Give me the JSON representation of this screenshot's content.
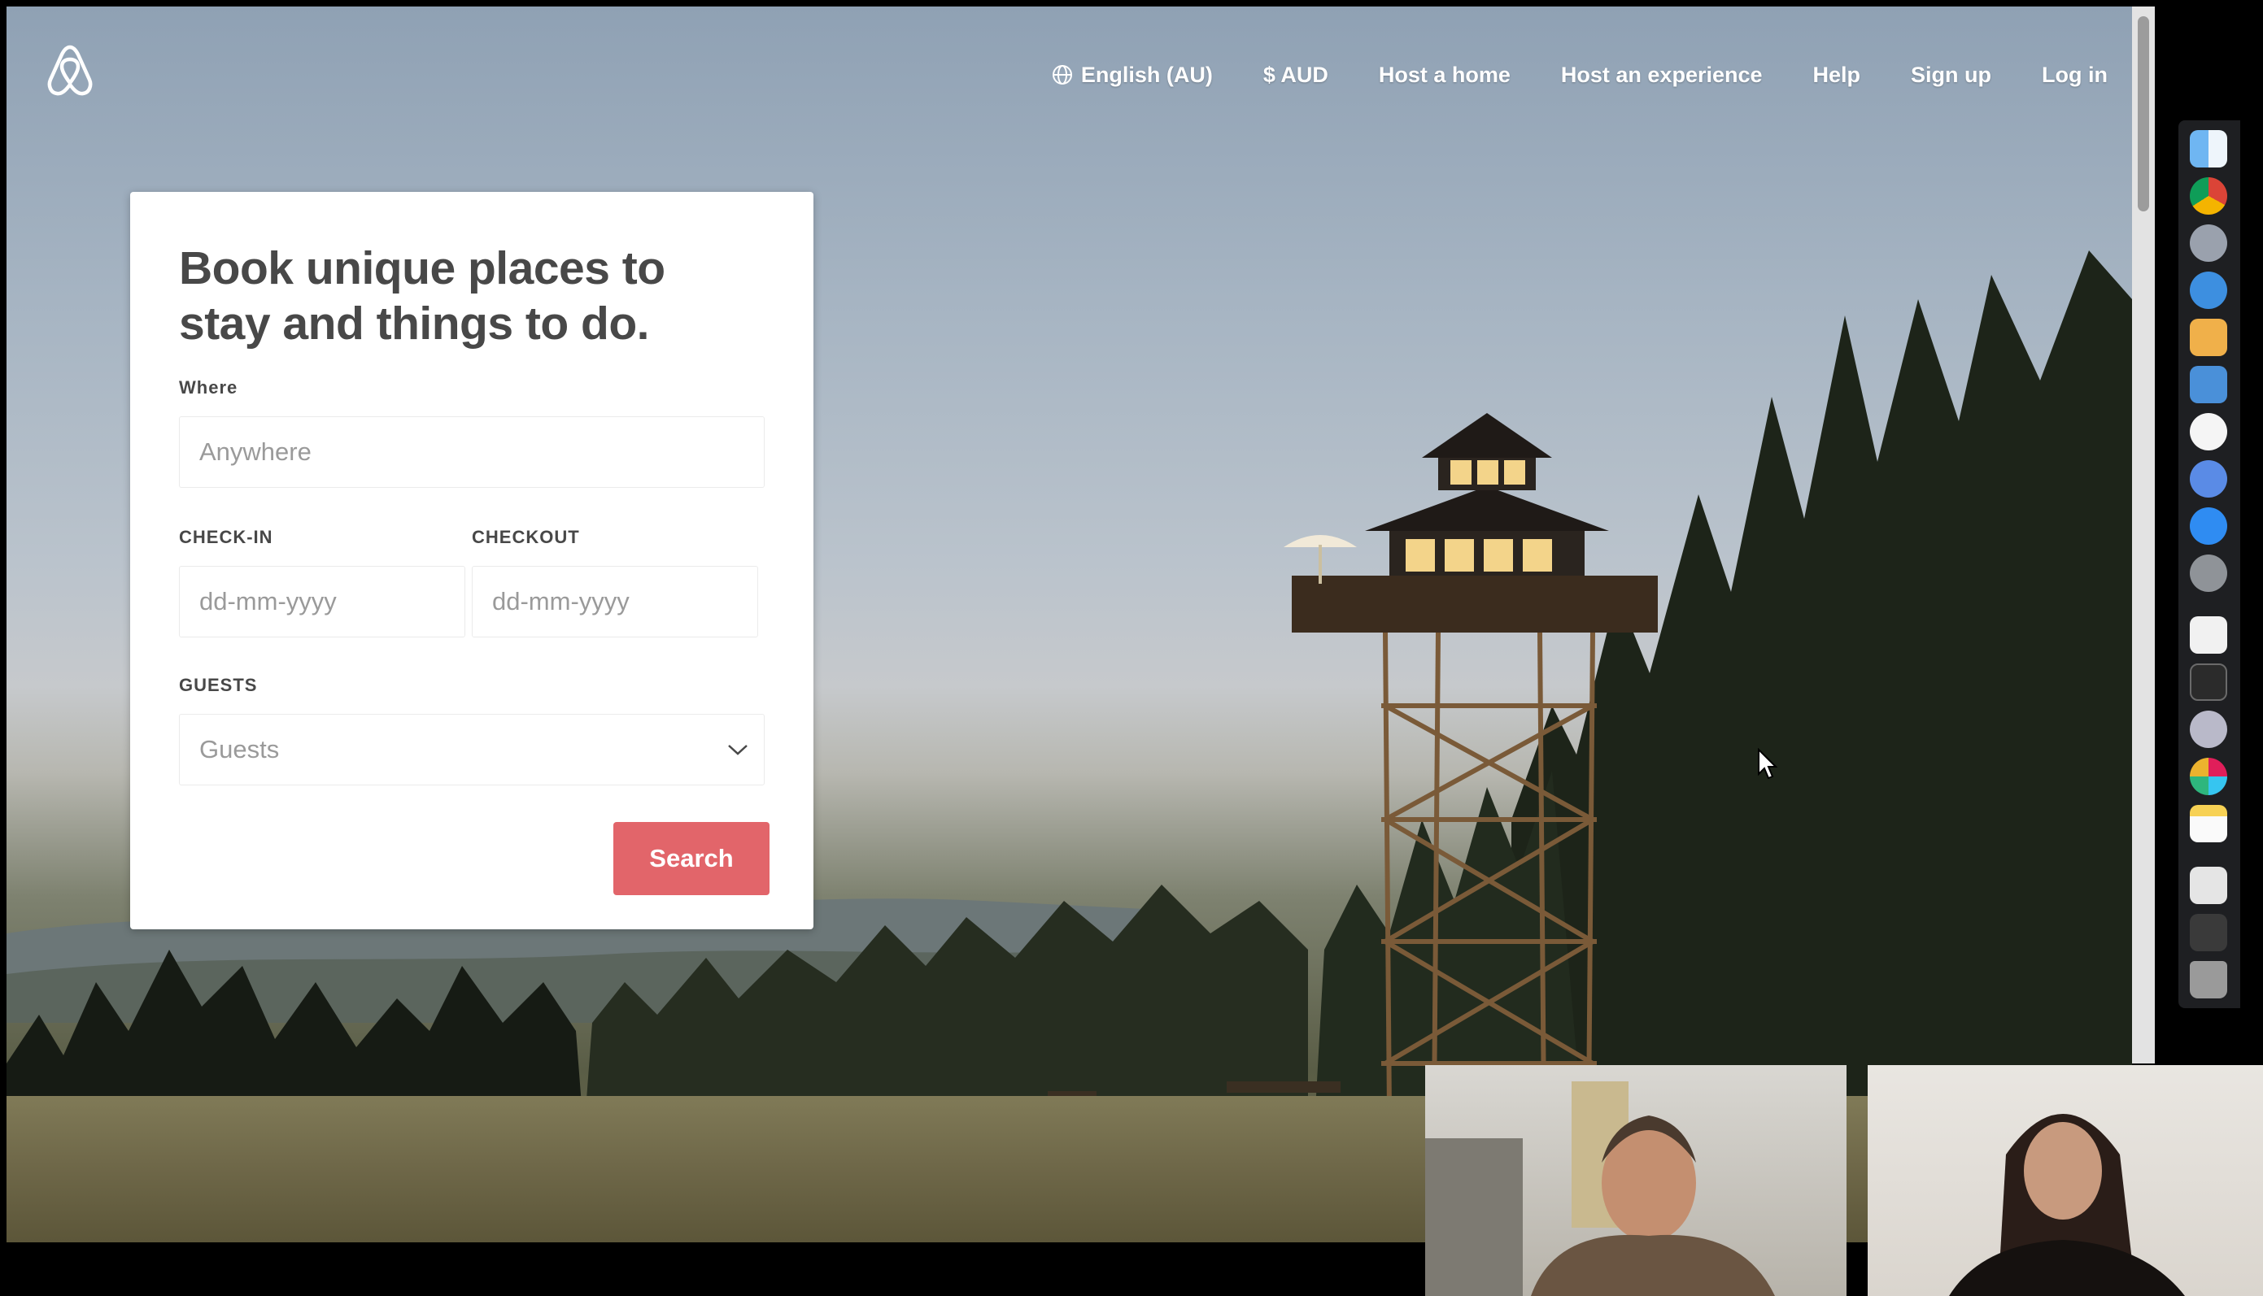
{
  "nav": {
    "language": "English (AU)",
    "currency": "$ AUD",
    "host_home": "Host a home",
    "host_experience": "Host an experience",
    "help": "Help",
    "signup": "Sign up",
    "login": "Log in"
  },
  "card": {
    "headline": "Book unique places to stay and things to do.",
    "where_label": "Where",
    "where_placeholder": "Anywhere",
    "checkin_label": "CHECK-IN",
    "checkin_placeholder": "dd-mm-yyyy",
    "checkout_label": "CHECKOUT",
    "checkout_placeholder": "dd-mm-yyyy",
    "guests_label": "GUESTS",
    "guests_value": "Guests",
    "search_label": "Search"
  },
  "colors": {
    "brand": "#e2656a",
    "text": "#484848"
  },
  "dock": {
    "icons": [
      "finder-icon",
      "chrome-icon",
      "launchpad-icon",
      "safari-icon",
      "stickies-icon",
      "keynote-icon",
      "itunes-icon",
      "siri-icon",
      "app-store-icon",
      "system-preferences-icon",
      "textedit-icon",
      "terminal-icon",
      "photo-booth-icon",
      "slack-icon",
      "notes-icon",
      "preview-icon",
      "folder-icon",
      "trash-icon"
    ]
  }
}
